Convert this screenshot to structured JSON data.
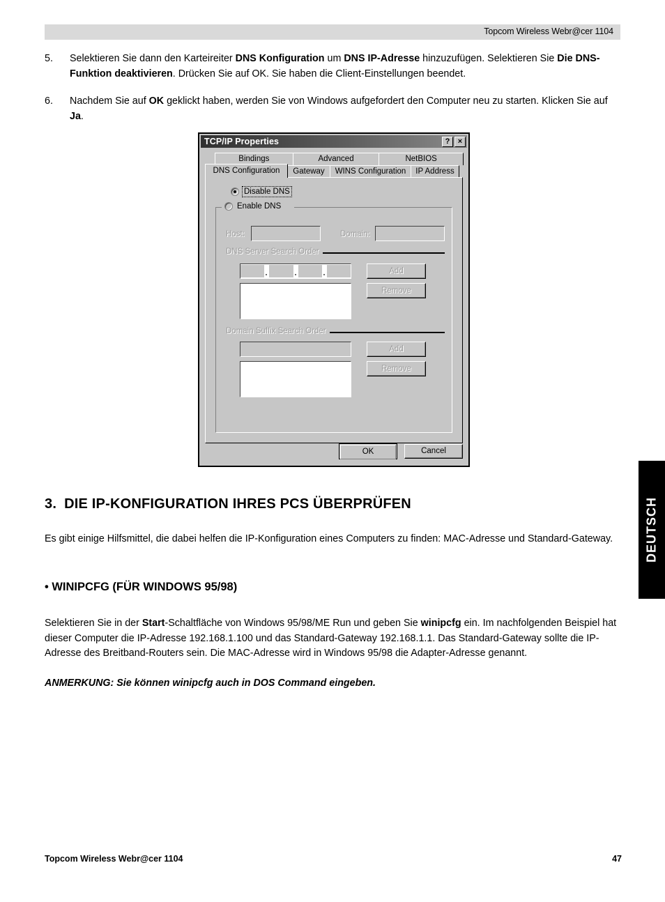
{
  "header": {
    "band_text": "Topcom Wireless Webr@cer 1104"
  },
  "steps": [
    {
      "num": "5.",
      "html": "Selektieren Sie dann den Karteireiter <b>DNS Konfiguration</b> um <b>DNS IP-Adresse</b> hinzuzufügen. Selektieren Sie <b>Die DNS-Funktion deaktivieren</b>. Drücken Sie auf OK. Sie haben die Client-Einstellungen beendet."
    },
    {
      "num": "6.",
      "html": "Nachdem Sie auf <b>OK</b> geklickt haben, werden Sie von Windows aufgefordert den Computer neu zu starten. Klicken Sie auf <b>Ja</b>."
    }
  ],
  "dialog": {
    "title": "TCP/IP Properties",
    "help_button": "?",
    "close_button": "×",
    "tabs_row1": [
      "Bindings",
      "Advanced",
      "NetBIOS"
    ],
    "tabs_row2": [
      "DNS Configuration",
      "Gateway",
      "WINS Configuration",
      "IP Address"
    ],
    "active_tab": "DNS Configuration",
    "radio_disable": "Disable DNS",
    "radio_enable": "Enable DNS",
    "label_host": "Host:",
    "label_domain": "Domain:",
    "value_host": "",
    "value_domain": "",
    "group_dns_server": "DNS Server Search Order",
    "group_domain_suffix": "Domain Suffix Search Order",
    "btn_add": "Add",
    "btn_remove": "Remove",
    "ip_value": "   .   .   .   ",
    "suffix_value": "",
    "dns_list_items": [],
    "suffix_list_items": [],
    "btn_ok": "OK",
    "btn_cancel": "Cancel"
  },
  "section": {
    "number": "3.",
    "title": "DIE IP-KONFIGURATION IHRES PCS ÜBERPRÜFEN",
    "intro": "Es gibt einige Hilfsmittel, die dabei helfen die IP-Konfiguration eines Computers zu finden: MAC-Adresse und Standard-Gateway.",
    "subheading": "• WINIPCFG (FÜR WINDOWS 95/98)",
    "body_html": "Selektieren Sie in der <b>Start</b>-Schaltfläche von Windows 95/98/ME Run und geben Sie <b>winipcfg</b> ein. Im nachfolgenden Beispiel hat dieser Computer die IP-Adresse 192.168.1.100 und das Standard-Gateway 192.168.1.1. Das Standard-Gateway sollte die IP-Adresse des Breitband-Routers sein. Die MAC-Adresse wird in Windows 95/98 die Adapter-Adresse genannt.",
    "note": "ANMERKUNG: Sie können winipcfg auch in DOS Command eingeben."
  },
  "sidetab": {
    "label": "DEUTSCH"
  },
  "footer": {
    "left": "Topcom Wireless Webr@cer 1104",
    "page": "47"
  }
}
